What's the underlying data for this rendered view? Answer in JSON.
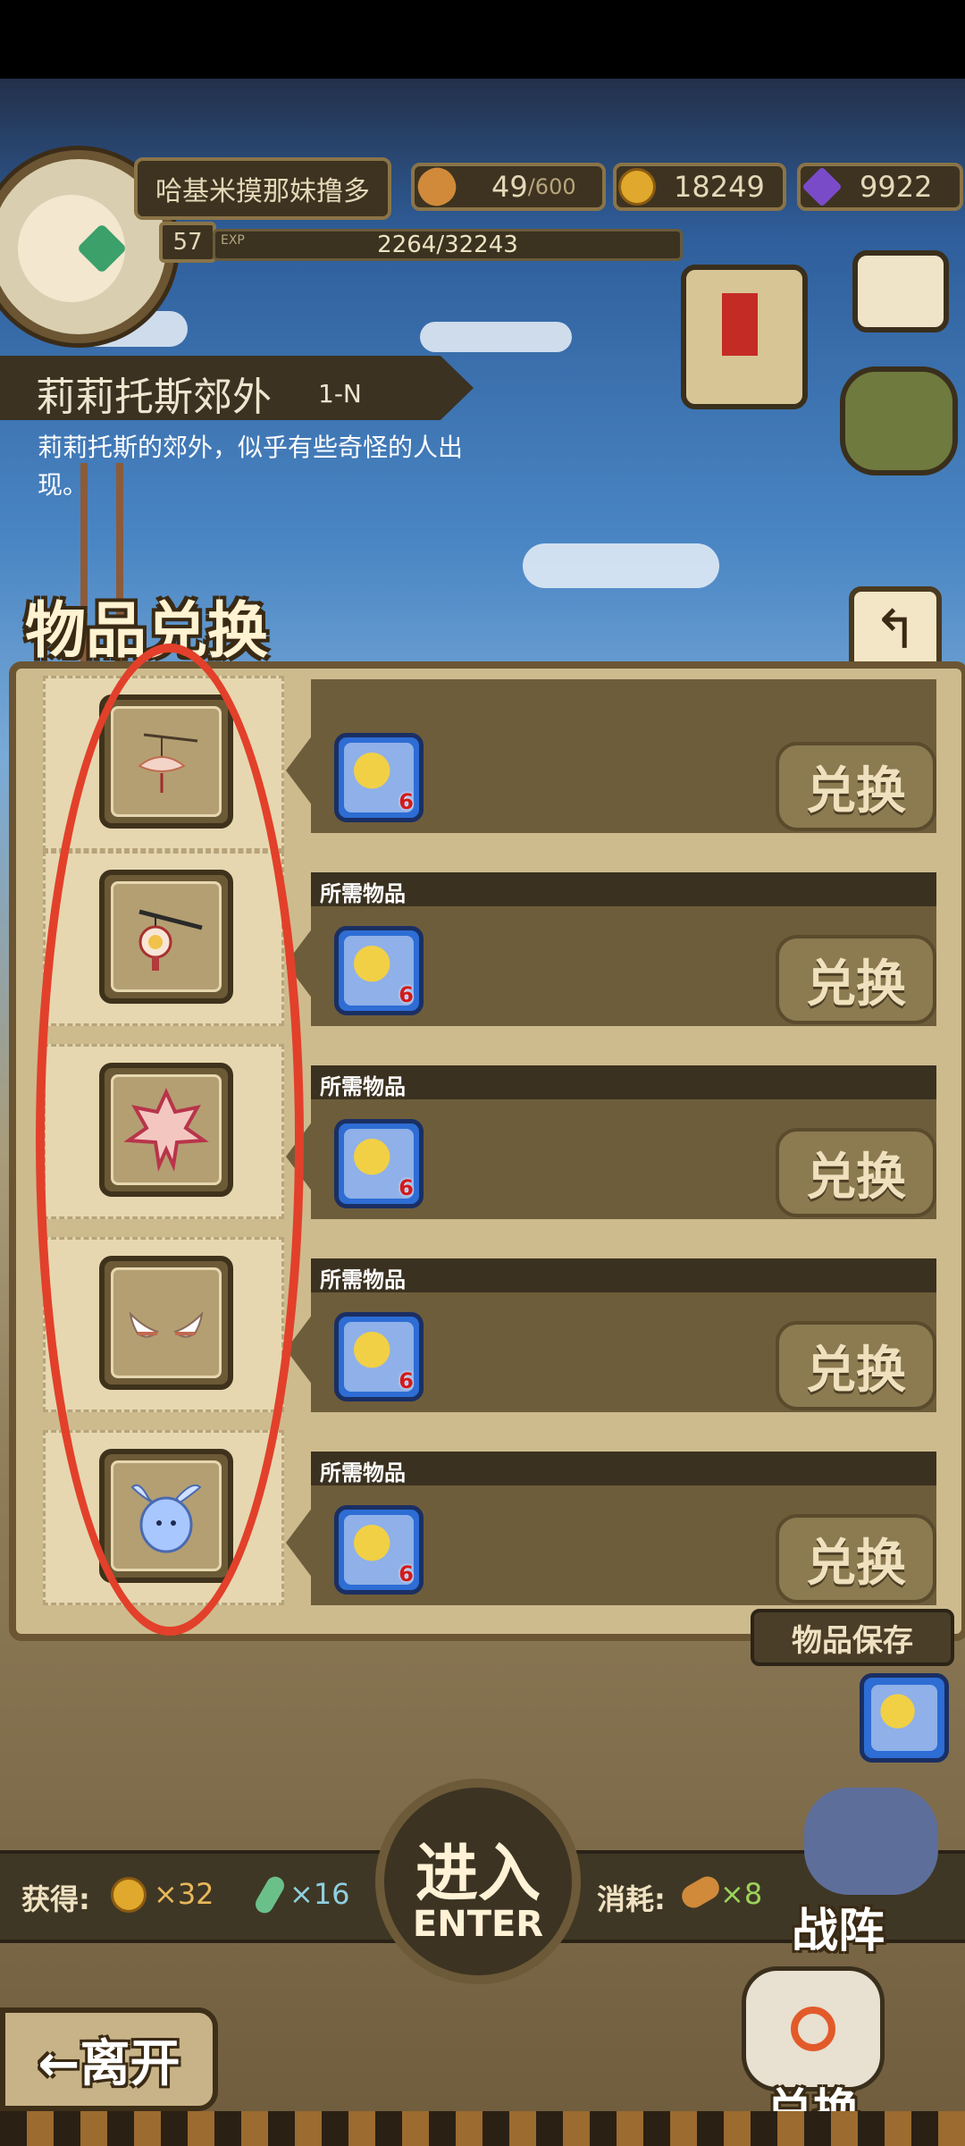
{
  "player": {
    "name": "哈基米摸那妹撸多",
    "level": "57",
    "exp_label": "EXP",
    "exp": "2264/32243"
  },
  "resources": {
    "stamina_current": "49",
    "stamina_max": "/600",
    "gold": "18249",
    "gems": "9922"
  },
  "location": {
    "title": "莉莉托斯郊外",
    "code": "1-N",
    "description": "莉莉托斯的郊外，似乎有些奇怪的人出现。"
  },
  "panel": {
    "title": "物品兑换",
    "back_icon": "return-arrow-icon",
    "rows": [
      {
        "item_icon": "lotus-lantern-icon",
        "req_label": "",
        "req_item_icon": "wheat-bundle-icon",
        "req_count": "6",
        "button": "兑换"
      },
      {
        "item_icon": "flower-lantern-icon",
        "req_label": "所需物品",
        "req_item_icon": "wheat-bundle-icon",
        "req_count": "6",
        "button": "兑换"
      },
      {
        "item_icon": "maple-leaf-icon",
        "req_label": "所需物品",
        "req_item_icon": "wheat-bundle-icon",
        "req_count": "6",
        "button": "兑换"
      },
      {
        "item_icon": "angel-wings-icon",
        "req_label": "所需物品",
        "req_item_icon": "wheat-bundle-icon",
        "req_count": "6",
        "button": "兑换"
      },
      {
        "item_icon": "blue-slime-icon",
        "req_label": "所需物品",
        "req_item_icon": "wheat-bundle-icon",
        "req_count": "6",
        "button": "兑换"
      }
    ]
  },
  "bottom": {
    "obtain_label": "获得:",
    "obtain_gold": "×32",
    "obtain_feather": "×16",
    "consume_label": "消耗:",
    "consume_stamina": "×8",
    "enter_cn": "进入",
    "enter_en": "ENTER",
    "formation": "战阵",
    "leave": "←离开",
    "exchange": "兑换",
    "storage": "物品保存"
  },
  "colors": {
    "annotation_circle": "#e2402a",
    "button_text": "#efe1bd",
    "req_count": "#d21b1b"
  }
}
